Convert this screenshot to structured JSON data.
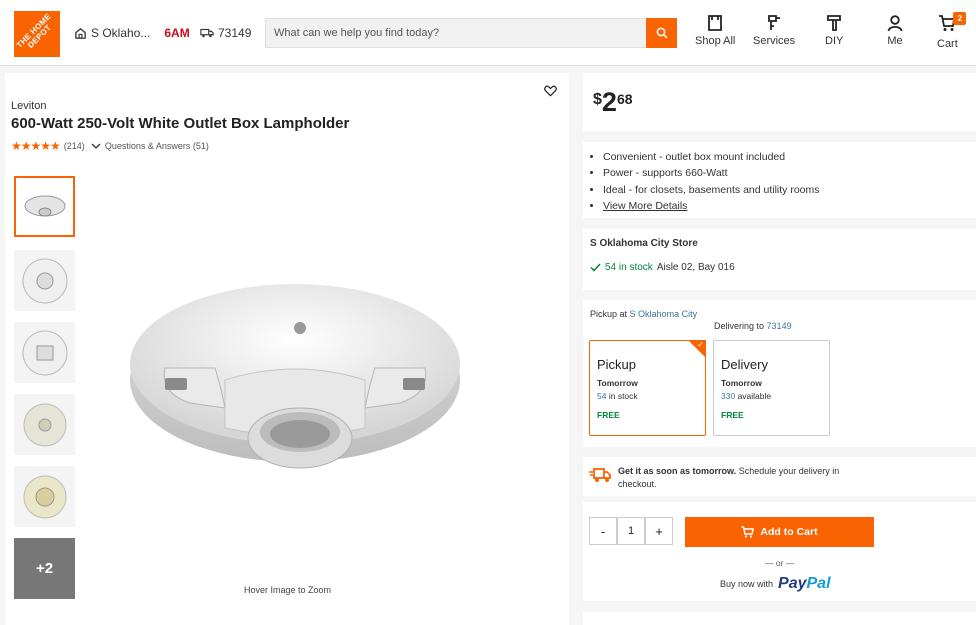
{
  "header": {
    "logo_text": "THE HOME DEPOT",
    "store_name": "S Oklaho...",
    "store_hours": "6AM",
    "zip": "73149",
    "search_placeholder": "What can we help you find today?",
    "nav": [
      {
        "label": "Shop All",
        "icon": "shop-all-icon"
      },
      {
        "label": "Services",
        "icon": "services-icon"
      },
      {
        "label": "DIY",
        "icon": "hammer-icon"
      },
      {
        "label": "Me",
        "icon": "person-icon"
      },
      {
        "label": "Cart",
        "icon": "cart-icon"
      }
    ],
    "cart_count": "2"
  },
  "product": {
    "brand": "Leviton",
    "title": "600-Watt 250-Volt White Outlet Box Lampholder",
    "stars": "★★★★★",
    "rating": 4.5,
    "review_count": "(214)",
    "qa_label": "Questions & Answers (51)",
    "more_images": "+2",
    "zoom_hint": "Hover Image to Zoom"
  },
  "price": {
    "currency": "$",
    "dollars": "2",
    "cents": "68"
  },
  "highlights": [
    "Convenient - outlet box mount included",
    "Power - supports 660-Watt",
    "Ideal - for closets, basements and utility rooms"
  ],
  "view_more": "View More Details",
  "store": {
    "name": "S Oklahoma City Store",
    "stock": "54 in stock",
    "aisle": "Aisle 02, Bay 016"
  },
  "fulfillment": {
    "pickup_at_label": "Pickup at",
    "pickup_store": "S Oklahoma City",
    "delivering_label": "Delivering to",
    "delivering_zip": "73149",
    "pickup": {
      "title": "Pickup",
      "when": "Tomorrow",
      "qty_num": "54",
      "qty_text": "in stock",
      "price": "FREE"
    },
    "delivery": {
      "title": "Delivery",
      "when": "Tomorrow",
      "qty_num": "330",
      "qty_text": "available",
      "price": "FREE"
    }
  },
  "shipping_msg": {
    "bold": "Get it as soon as tomorrow.",
    "rest": "Schedule your delivery in checkout."
  },
  "cart": {
    "minus": "-",
    "qty": "1",
    "plus": "+",
    "add_label": "Add to Cart",
    "or": "— or —",
    "buy_now": "Buy now with",
    "paypal_a": "Pay",
    "paypal_b": "Pal"
  },
  "colors": {
    "brand_orange": "#f96302",
    "stock_green": "#00873c",
    "link_blue": "#3e7697"
  }
}
